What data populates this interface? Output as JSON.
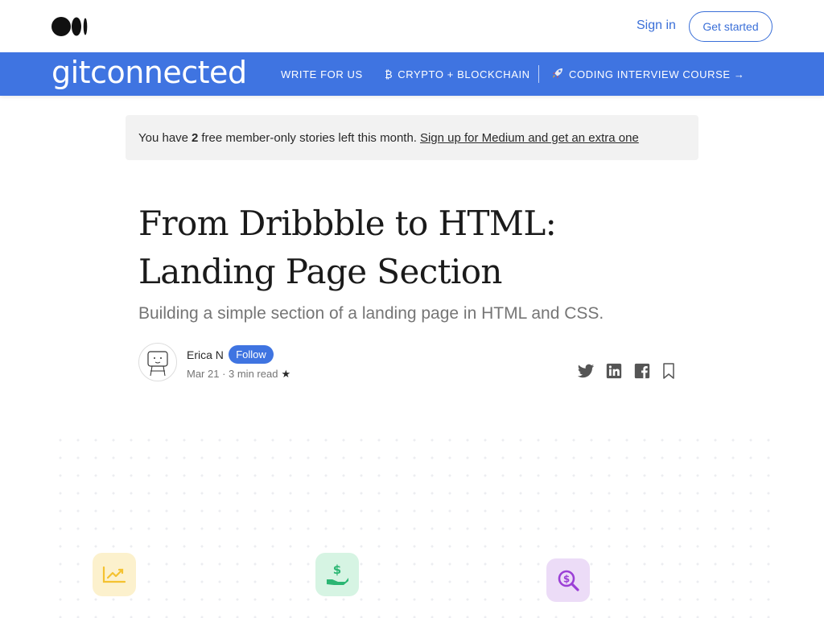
{
  "header": {
    "sign_in": "Sign in",
    "get_started": "Get started"
  },
  "publication": {
    "name": "gitconnected",
    "nav": {
      "write": "WRITE FOR US",
      "crypto": "CRYPTO + BLOCKCHAIN",
      "course": "CODING INTERVIEW COURSE →"
    }
  },
  "banner": {
    "prefix": "You have",
    "count": "2",
    "suffix": "free member-only stories left this month.",
    "link": "Sign up for Medium and get an extra one"
  },
  "article": {
    "title_line1": "From Dribbble to HTML:",
    "title_line2": "Landing Page Section",
    "subtitle": "Building a simple section of a landing page in HTML and CSS.",
    "author": "Erica N",
    "follow": "Follow",
    "meta": "Mar 21 · 3 min read",
    "star": "★"
  },
  "colors": {
    "accent": "#3f74e1",
    "banner_bg": "#f2f2f2",
    "feature_yellow": "#fcf1cd",
    "feature_green": "#d6f4e3",
    "feature_purple": "#ecdcf7"
  },
  "icons": [
    "medium-logo-icon",
    "bitcoin-icon",
    "rocket-icon",
    "twitter-icon",
    "linkedin-icon",
    "facebook-icon",
    "bookmark-icon",
    "chart-growth-icon",
    "money-hand-icon",
    "search-dollar-icon"
  ]
}
